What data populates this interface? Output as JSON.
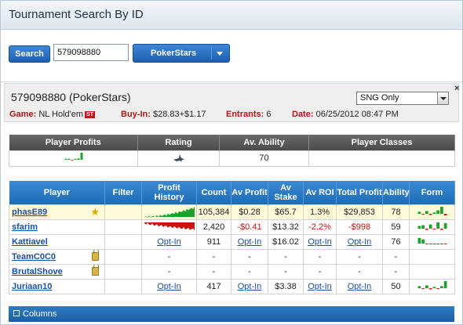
{
  "title": "Tournament Search By ID",
  "search": {
    "button_label": "Search",
    "input_value": "579098880",
    "site_button_label": "PokerStars"
  },
  "tournament": {
    "title": "579098880 (PokerStars)",
    "filter_value": "SNG Only",
    "close_label": "×",
    "game_label": "Game:",
    "game_value": "NL Hold'em",
    "game_badge": "ST",
    "buyin_label": "Buy-In:",
    "buyin_value": "$28.83+$1.17",
    "entrants_label": "Entrants:",
    "entrants_value": "6",
    "date_label": "Date:",
    "date_value": "06/25/2012 08:47 PM"
  },
  "summary": {
    "headers": [
      "Player Profits",
      "Rating",
      "Av. Ability",
      "Player Classes"
    ],
    "av_ability": "70",
    "rating_icon": "shark-icon",
    "profit_spark": [
      0.15,
      0.15,
      -0.2,
      0.15,
      0.2,
      1.0
    ]
  },
  "players": {
    "headers": [
      "Player",
      "Filter",
      "Profit History",
      "Count",
      "Av Profit",
      "Av Stake",
      "Av ROI",
      "Total Profit",
      "Ability",
      "Form"
    ],
    "rows": [
      {
        "name": "phasE89",
        "icon": "star-icon",
        "history": "positive",
        "count": "105,384",
        "av_profit": "$0.28",
        "av_stake": "$65.7",
        "av_roi": "1.3%",
        "total_profit": "$29,853",
        "ability": "78",
        "highlight": true,
        "neg": false
      },
      {
        "name": "sfarim",
        "icon": "",
        "history": "negative",
        "count": "2,420",
        "av_profit": "-$0.41",
        "av_stake": "$13.32",
        "av_roi": "-2.2%",
        "total_profit": "-$998",
        "ability": "59",
        "highlight": false,
        "neg": true
      },
      {
        "name": "Kattiavel",
        "icon": "",
        "history": "Opt-In",
        "count": "911",
        "av_profit": "Opt-In",
        "av_stake": "$16.02",
        "av_roi": "Opt-In",
        "total_profit": "Opt-In",
        "ability": "76",
        "highlight": false,
        "neg": false
      },
      {
        "name": "TeamC0C0",
        "icon": "lock-icon",
        "history": "-",
        "count": "-",
        "av_profit": "-",
        "av_stake": "-",
        "av_roi": "-",
        "total_profit": "-",
        "ability": "-",
        "highlight": false,
        "neg": false
      },
      {
        "name": "BrutalShove",
        "icon": "lock-icon",
        "history": "-",
        "count": "-",
        "av_profit": "-",
        "av_stake": "-",
        "av_roi": "-",
        "total_profit": "-",
        "ability": "-",
        "highlight": false,
        "neg": false
      },
      {
        "name": "Juriaan10",
        "icon": "",
        "history": "Opt-In",
        "count": "417",
        "av_profit": "Opt-In",
        "av_stake": "$3.38",
        "av_roi": "Opt-In",
        "total_profit": "Opt-In",
        "ability": "50",
        "highlight": false,
        "neg": false
      }
    ],
    "forms": [
      [
        0.3,
        -0.2,
        0.4,
        -0.3,
        0.2,
        0.5,
        1.0,
        -0.4
      ],
      [
        0.4,
        0.5,
        -0.3,
        0.6,
        -0.2,
        0.9,
        -0.3,
        0.8
      ],
      [
        0.8,
        0.6,
        -0.1,
        -0.1,
        -0.2,
        -0.1,
        -0.1,
        -0.1
      ],
      [],
      [],
      [
        0.3,
        -0.2,
        0.4,
        -0.3,
        0.2,
        -0.2,
        0.3,
        1.0
      ]
    ]
  },
  "footer": {
    "columns_label": "Columns"
  },
  "colors": {
    "accent": "#1f6cb6",
    "negative": "#cc1111",
    "positive": "#22a02c"
  }
}
